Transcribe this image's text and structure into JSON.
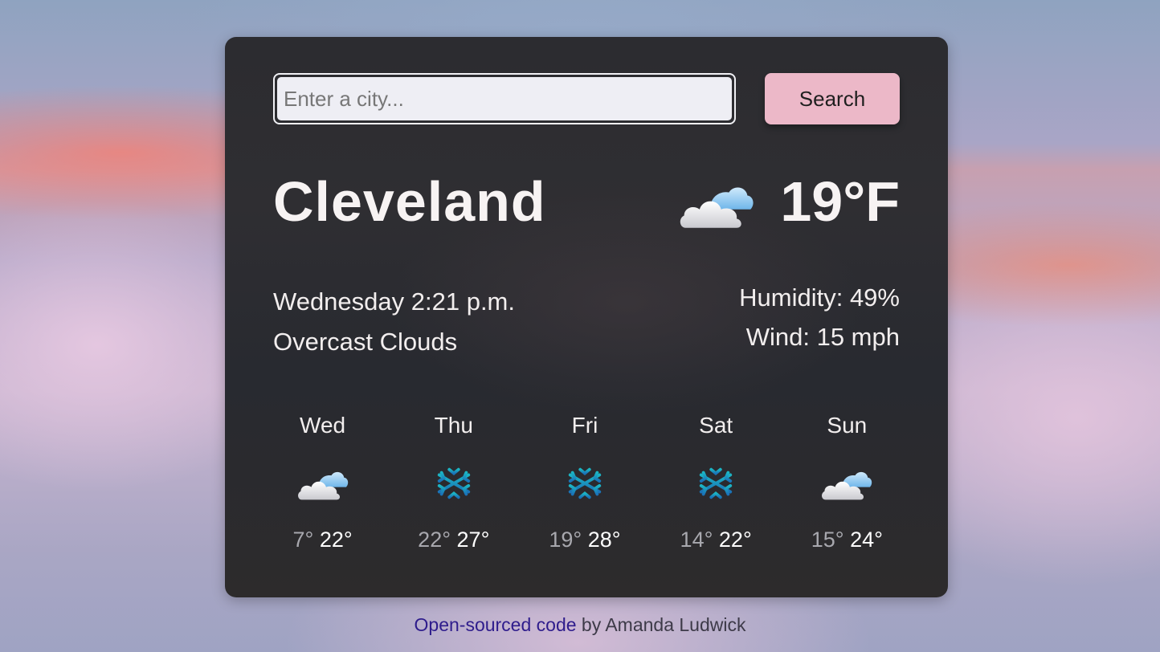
{
  "search": {
    "placeholder": "Enter a city...",
    "value": "",
    "button_label": "Search"
  },
  "current": {
    "city": "Cleveland",
    "temperature": "19°F",
    "icon": "cloud-icon",
    "datetime": "Wednesday 2:21 p.m.",
    "description": "Overcast Clouds",
    "humidity": "Humidity: 49%",
    "wind": "Wind: 15 mph"
  },
  "forecast": [
    {
      "day": "Wed",
      "icon": "cloud-icon",
      "min": "7°",
      "max": "22°"
    },
    {
      "day": "Thu",
      "icon": "snowflake-icon",
      "min": "22°",
      "max": "27°"
    },
    {
      "day": "Fri",
      "icon": "snowflake-icon",
      "min": "19°",
      "max": "28°"
    },
    {
      "day": "Sat",
      "icon": "snowflake-icon",
      "min": "14°",
      "max": "22°"
    },
    {
      "day": "Sun",
      "icon": "cloud-icon",
      "min": "15°",
      "max": "24°"
    }
  ],
  "footer": {
    "link_text": "Open-sourced code",
    "author_text": " by Amanda Ludwick"
  },
  "colors": {
    "search_button": "#ecb8c8",
    "card_background": "#2c2c30",
    "footer_link": "#2e1c8c"
  }
}
